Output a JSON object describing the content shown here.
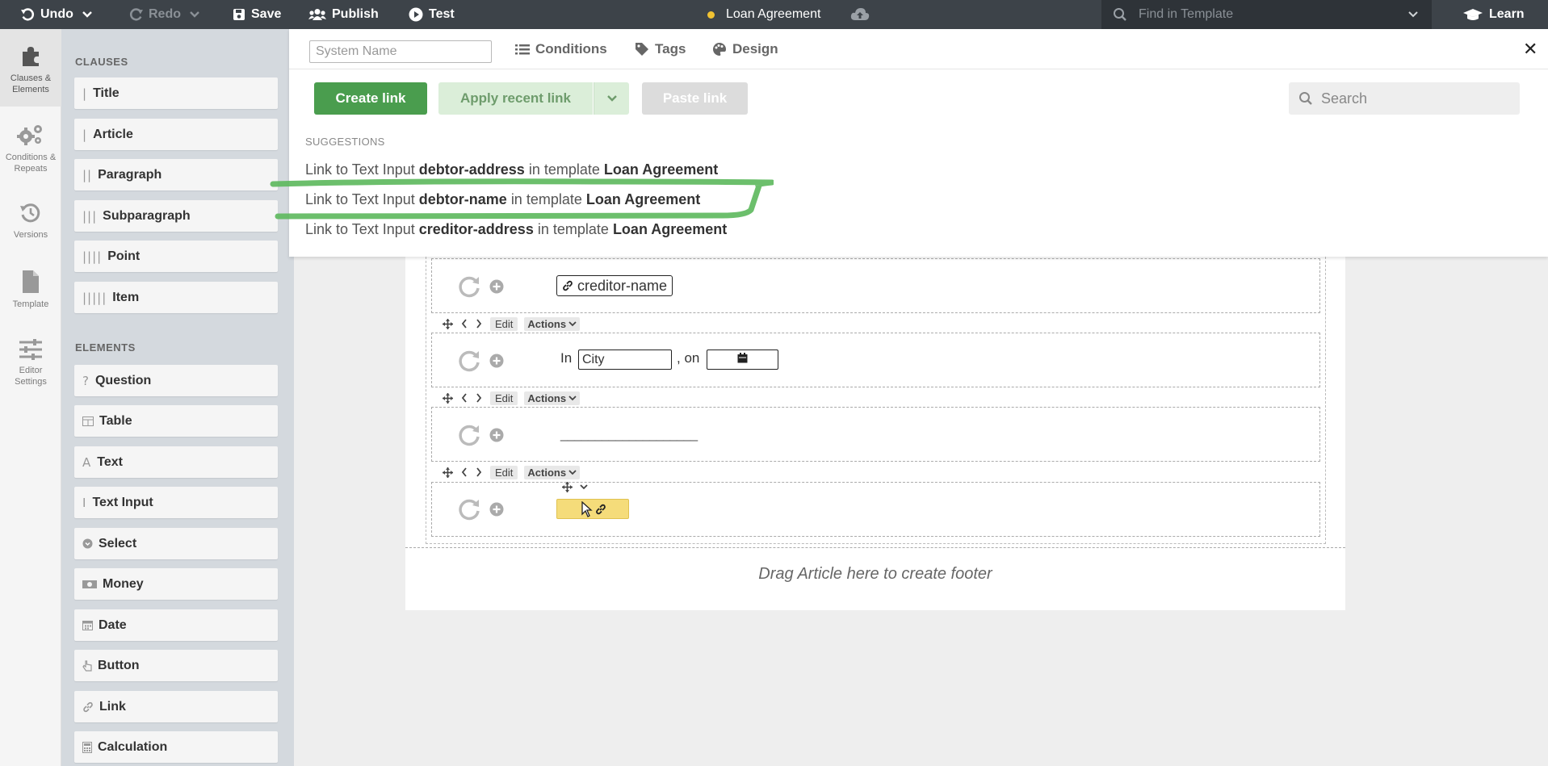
{
  "topbar": {
    "undo_label": "Undo",
    "redo_label": "Redo",
    "save_label": "Save",
    "publish_label": "Publish",
    "test_label": "Test",
    "document_title": "Loan Agreement",
    "find_placeholder": "Find in Template",
    "learn_label": "Learn"
  },
  "rail": {
    "items": [
      {
        "label_1": "Clauses &",
        "label_2": "Elements",
        "icon": "puzzle-icon"
      },
      {
        "label_1": "Conditions &",
        "label_2": "Repeats",
        "icon": "gears-icon"
      },
      {
        "label_1": "Versions",
        "label_2": "",
        "icon": "history-icon"
      },
      {
        "label_1": "Template",
        "label_2": "",
        "icon": "file-icon"
      },
      {
        "label_1": "Editor",
        "label_2": "Settings",
        "icon": "sliders-icon"
      }
    ]
  },
  "palette": {
    "clauses_heading": "CLAUSES",
    "elements_heading": "ELEMENTS",
    "clauses": [
      "Title",
      "Article",
      "Paragraph",
      "Subparagraph",
      "Point",
      "Item"
    ],
    "elements": [
      "Question",
      "Table",
      "Text",
      "Text Input",
      "Select",
      "Money",
      "Date",
      "Button",
      "Link",
      "Calculation"
    ]
  },
  "panel": {
    "system_name_placeholder": "System Name",
    "tabs": [
      "Conditions",
      "Tags",
      "Design"
    ],
    "create_link_label": "Create link",
    "apply_recent_label": "Apply recent link",
    "paste_link_label": "Paste link",
    "search_placeholder": "Search",
    "suggestions_heading": "SUGGESTIONS",
    "suggestions": [
      {
        "prefix": "Link to Text Input",
        "field": "debtor-address",
        "middle": "in template",
        "template": "Loan Agreement"
      },
      {
        "prefix": "Link to Text Input",
        "field": "debtor-name",
        "middle": "in template",
        "template": "Loan Agreement"
      },
      {
        "prefix": "Link to Text Input",
        "field": "creditor-address",
        "middle": "in template",
        "template": "Loan Agreement"
      }
    ],
    "highlight_color": "#5cb85c"
  },
  "document": {
    "toolbar_edit": "Edit",
    "toolbar_actions": "Actions",
    "creditor_field": "creditor-name",
    "in_label": "In",
    "city_value": "City",
    "on_label": ", on",
    "signature_line": "____________________",
    "footer_hint": "Drag Article here to create footer"
  },
  "colors": {
    "topbar": "#3d4349",
    "primary_green": "#4a9d4e",
    "new_field_yellow": "#f5dc7a"
  }
}
